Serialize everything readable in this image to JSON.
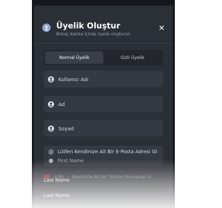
{
  "header": {
    "title": "Üyelik Oluştur",
    "subtitle": "Birkaç dakika içinde üyelik oluşturun."
  },
  "tabs": [
    {
      "label": "Normal Üyelik",
      "active": true
    },
    {
      "label": "Gizli Üyelik",
      "active": false
    }
  ],
  "form": {
    "username_placeholder": "Kullanıcı Adı",
    "name_placeholder": "Ad",
    "surname_placeholder": "Soyad",
    "email_placeholder": "Lütfen Kendinize Ait Bir E-Posta Adresi Gi",
    "first_name_ghost": "First Name",
    "phone_code": "+90",
    "phone_placeholder": "Kendinize Ait Bir Telefon Numarası Gi",
    "last_name_ghost_1": "Last Name",
    "last_name_ghost_2": "Last Name"
  },
  "colors": {
    "background": "#2a2e35",
    "field": "#353941",
    "accent_icon": "#8aa8d8",
    "flag": "#d9262c"
  },
  "icons": {
    "header": "user-circle-icon",
    "close": "close-icon",
    "field": "user-icon",
    "email": "at-icon"
  }
}
